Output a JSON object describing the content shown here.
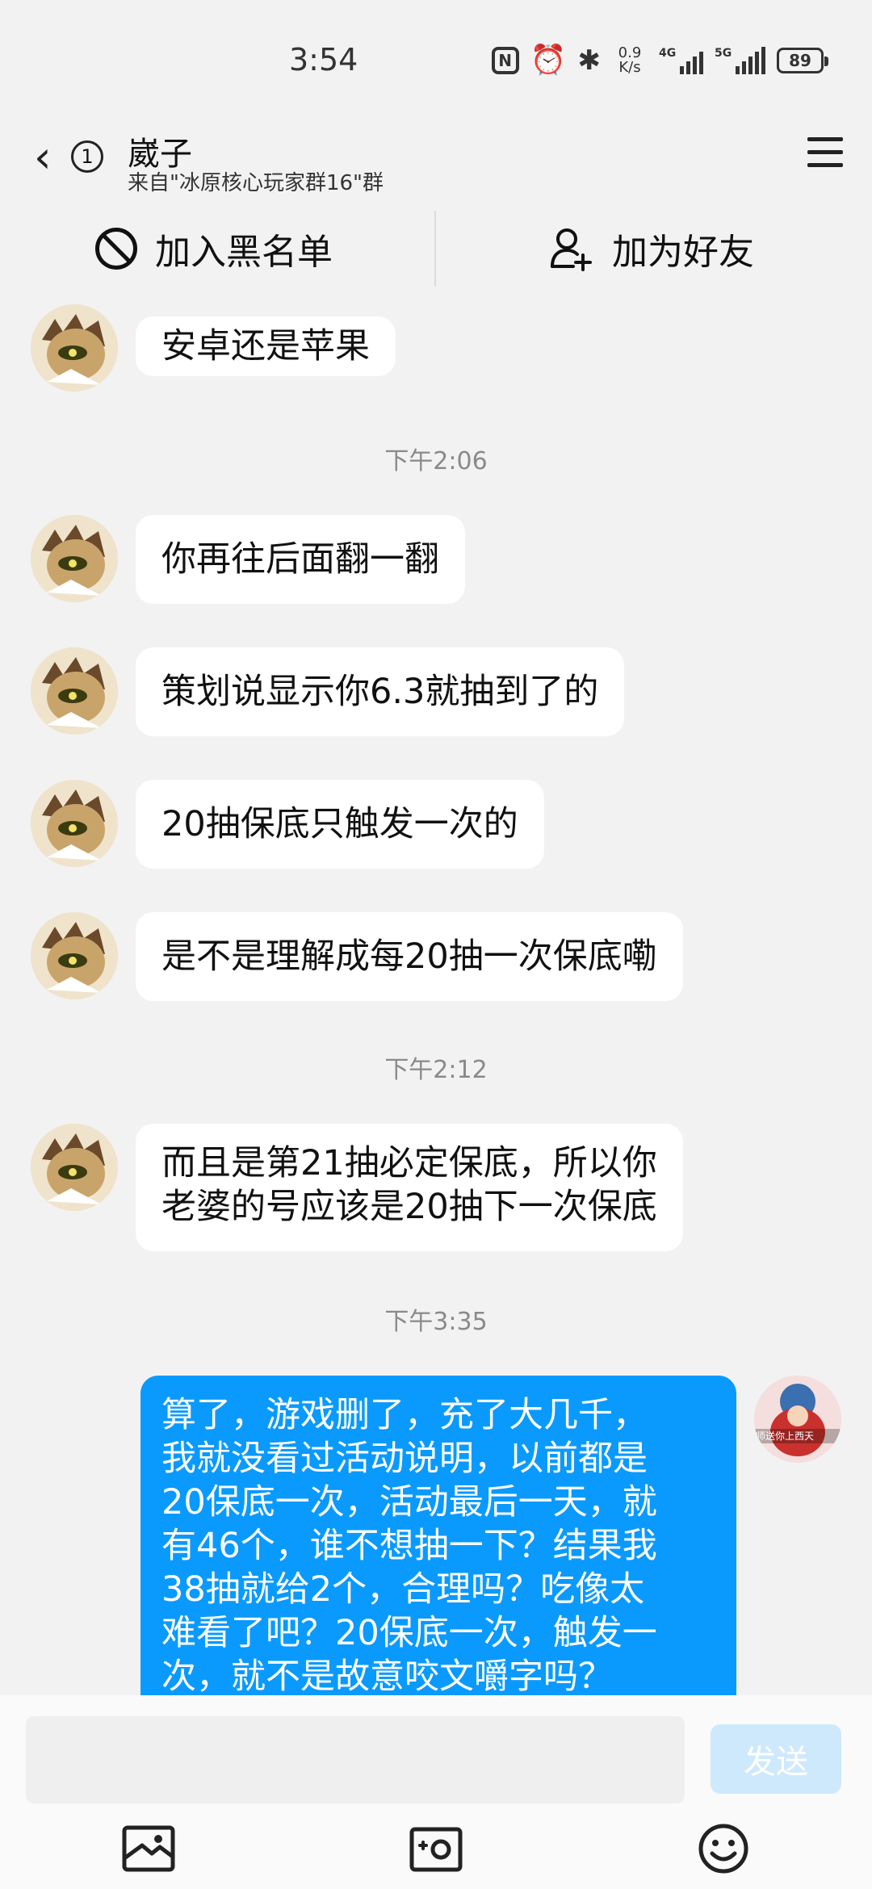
{
  "status_bar": {
    "time": "3:54",
    "nfc": "N",
    "speed": "0.9\nK/s",
    "sig1_label": "4G",
    "sig2_label": "5G",
    "battery": "89",
    "icons": [
      "nfc-icon",
      "alarm-icon",
      "bluetooth-icon",
      "signal-icon",
      "battery-icon"
    ]
  },
  "header": {
    "unread_count": "1",
    "contact_name": "崴子",
    "source": "来自\"冰原核心玩家群16\"群"
  },
  "actions": {
    "blacklist_label": "加入黑名单",
    "add_friend_label": "加为好友"
  },
  "messages": [
    {
      "text": "安卓还是苹果"
    },
    {
      "timestamp": "下午2:06"
    },
    {
      "text": "你再往后面翻一翻"
    },
    {
      "text": "策划说显示你6.3就抽到了的"
    },
    {
      "text": "20抽保底只触发一次的"
    },
    {
      "text": "是不是理解成每20抽一次保底嘞"
    },
    {
      "timestamp": "下午2:12"
    },
    {
      "line1": "而且是第21抽必定保底，所以你",
      "line2": "老婆的号应该是20抽下一次保底"
    },
    {
      "timestamp": "下午3:35"
    },
    {
      "lines": [
        "算了，游戏删了，充了大几千，",
        "我就没看过活动说明，以前都是",
        "20保底一次，活动最后一天，就",
        "有46个，谁不想抽一下？结果我",
        "38抽就给2个，合理吗？吃像太",
        "难看了吧？20保底一次，触发一",
        "次，就不是故意咬文嚼字吗？"
      ]
    }
  ],
  "self_avatar_caption": "师送你上西天",
  "input": {
    "send_label": "发送"
  },
  "colors": {
    "outgoing_bubble": "#0a9afe",
    "send_disabled": "#cfe9fc",
    "background": "#f2f2f2"
  }
}
